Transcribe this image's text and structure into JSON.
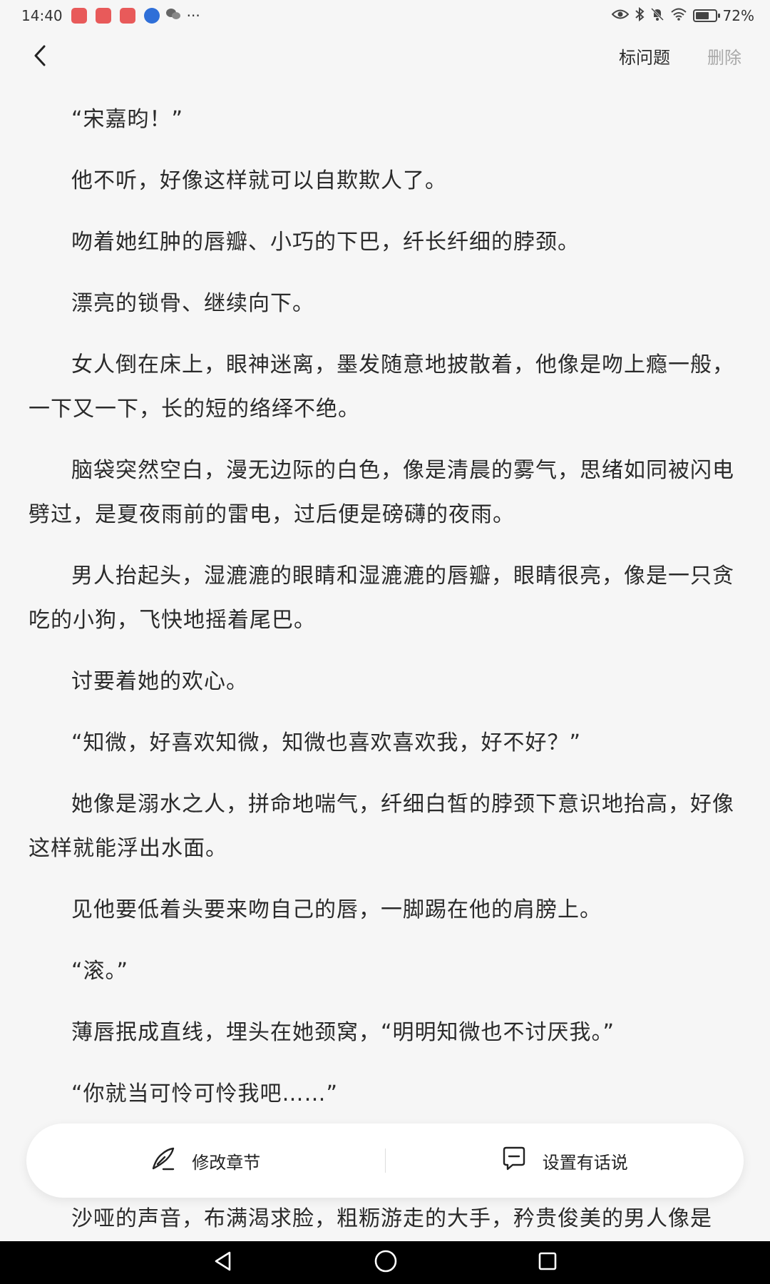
{
  "status_bar": {
    "time": "14:40",
    "more": "···",
    "battery_percent": "72%",
    "battery_level": 0.72,
    "icons": [
      "eye-icon",
      "bluetooth-icon",
      "bell-muted-icon",
      "wifi-icon",
      "battery-icon"
    ]
  },
  "nav": {
    "mark_label": "标问题",
    "delete_label": "删除"
  },
  "paragraphs": [
    "“宋嘉昀！”",
    "他不听，好像这样就可以自欺欺人了。",
    "吻着她红肿的唇瓣、小巧的下巴，纤长纤细的脖颈。",
    "漂亮的锁骨、继续向下。",
    "女人倒在床上，眼神迷离，墨发随意地披散着，他像是吻上瘾一般，一下又一下，长的短的络绎不绝。",
    "脑袋突然空白，漫无边际的白色，像是清晨的雾气，思绪如同被闪电劈过，是夏夜雨前的雷电，过后便是磅礴的夜雨。",
    "男人抬起头，湿漉漉的眼睛和湿漉漉的唇瓣，眼睛很亮，像是一只贪吃的小狗，飞快地摇着尾巴。",
    "讨要着她的欢心。",
    "“知微，好喜欢知微，知微也喜欢喜欢我，好不好？”",
    "她像是溺水之人，拼命地喘气，纤细白皙的脖颈下意识地抬高，好像这样就能浮出水面。",
    "见他要低着头要来吻自己的唇，一脚踢在他的肩膀上。",
    "“滚。”",
    "薄唇抿成直线，埋头在她颈窝，“明明知微也不讨厌我。”",
    "“你就当可怜可怜我吧……”"
  ],
  "tail_paragraph": "沙哑的声音，布满渴求脸，粗粝游走的大手，矜贵俊美的男人像是",
  "action_bar": {
    "edit_label": "修改章节",
    "comment_label": "设置有话说"
  }
}
